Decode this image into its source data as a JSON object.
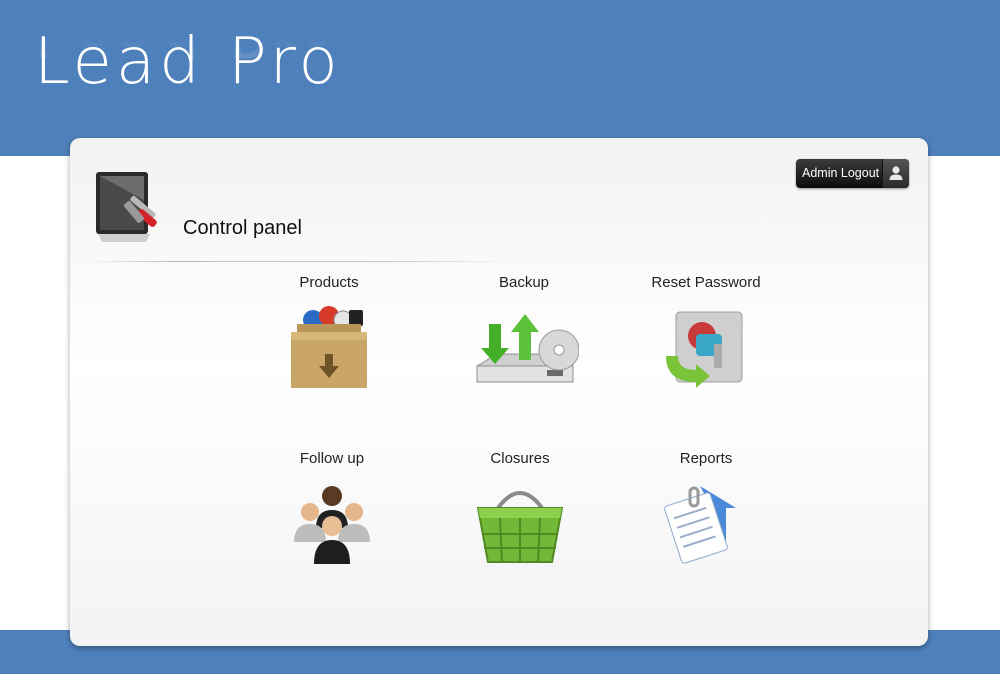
{
  "header": {
    "logo_text": "Lead Pro"
  },
  "panel": {
    "title": "Control panel",
    "logout_label": "Admin Logout"
  },
  "tiles": [
    {
      "label": "Products",
      "icon": "products-box-icon"
    },
    {
      "label": "Backup",
      "icon": "backup-drive-icon"
    },
    {
      "label": "Reset Password",
      "icon": "reset-password-icon"
    },
    {
      "label": "Follow up",
      "icon": "people-group-icon"
    },
    {
      "label": "Closures",
      "icon": "basket-icon"
    },
    {
      "label": "Reports",
      "icon": "report-document-icon"
    }
  ],
  "colors": {
    "band": "#4e80bb",
    "button": "#111111"
  }
}
